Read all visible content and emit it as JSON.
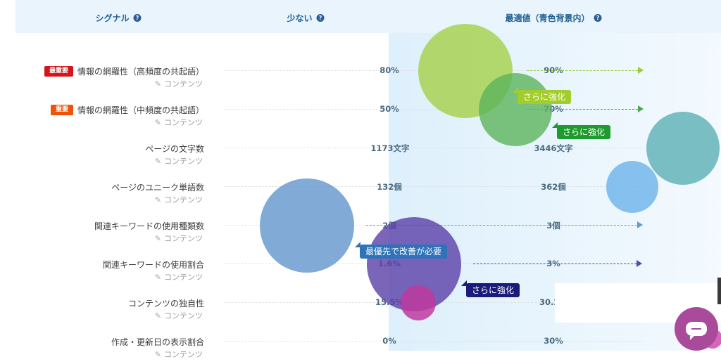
{
  "header": {
    "signal_label": "シグナル",
    "few_label": "少ない",
    "optimal_label": "最適値（青色背景内）"
  },
  "colors": {
    "accent": "#1f5f95",
    "critical_badge": "#d4161b",
    "important_badge": "#f0520a",
    "header_bg": "#e9f4fc"
  },
  "rows": [
    {
      "label": "情報の網羅性（高頻度の共起語）",
      "badge": "最重要",
      "sub": "コンテンツ",
      "current": "80%",
      "optimal": "90%",
      "arrow": "#9ccb3c"
    },
    {
      "label": "情報の網羅性（中頻度の共起語）",
      "badge": "重要",
      "sub": "コンテンツ",
      "current": "50%",
      "optimal": "70%",
      "arrow": "#4aa94a"
    },
    {
      "label": "ページの文字数",
      "badge": "",
      "sub": "コンテンツ",
      "current": "1173文字",
      "optimal": "3446文字",
      "arrow": ""
    },
    {
      "label": "ページのユニーク単語数",
      "badge": "",
      "sub": "コンテンツ",
      "current": "132個",
      "optimal": "362個",
      "arrow": ""
    },
    {
      "label": "関連キーワードの使用種類数",
      "badge": "",
      "sub": "コンテンツ",
      "current": "2個",
      "optimal": "3個",
      "arrow": "#6a9cc9"
    },
    {
      "label": "関連キーワードの使用割合",
      "badge": "",
      "sub": "コンテンツ",
      "current": "1.6%",
      "optimal": "3%",
      "arrow": "#5a4aa4"
    },
    {
      "label": "コンテンツの独自性",
      "badge": "",
      "sub": "コンテンツ",
      "current": "15.5%",
      "optimal": "30.2%",
      "arrow": ""
    },
    {
      "label": "作成・更新日の表示割合",
      "badge": "",
      "sub": "コンテンツ",
      "current": "0%",
      "optimal": "30%",
      "arrow": ""
    }
  ],
  "callouts": [
    {
      "text": "さらに強化",
      "color": "#a2cd2a"
    },
    {
      "text": "さらに強化",
      "color": "#1f9a2e"
    },
    {
      "text": "最優先で改善が必要",
      "color": "#2e72b8"
    },
    {
      "text": "さらに強化",
      "color": "#1b1b7a"
    }
  ],
  "chart_data": {
    "type": "table",
    "columns": [
      "シグナル",
      "少ない",
      "最適値（青色背景内）"
    ],
    "rows": [
      [
        "情報の網羅性（高頻度の共起語）",
        "80%",
        "90%"
      ],
      [
        "情報の網羅性（中頻度の共起語）",
        "50%",
        "70%"
      ],
      [
        "ページの文字数",
        "1173文字",
        "3446文字"
      ],
      [
        "ページのユニーク単語数",
        "132個",
        "362個"
      ],
      [
        "関連キーワードの使用種類数",
        "2個",
        "3個"
      ],
      [
        "関連キーワードの使用割合",
        "1.6%",
        "3%"
      ],
      [
        "コンテンツの独自性",
        "15.5%",
        "30.2%"
      ],
      [
        "作成・更新日の表示割合",
        "0%",
        "30%"
      ]
    ],
    "bubble_colors": [
      "#a8d252",
      "#5cb45c",
      "#5aafb3",
      "#72b6ec",
      "#6b9bd0",
      "#5a3fa8",
      "#c0399f",
      "#d04bb0"
    ]
  }
}
